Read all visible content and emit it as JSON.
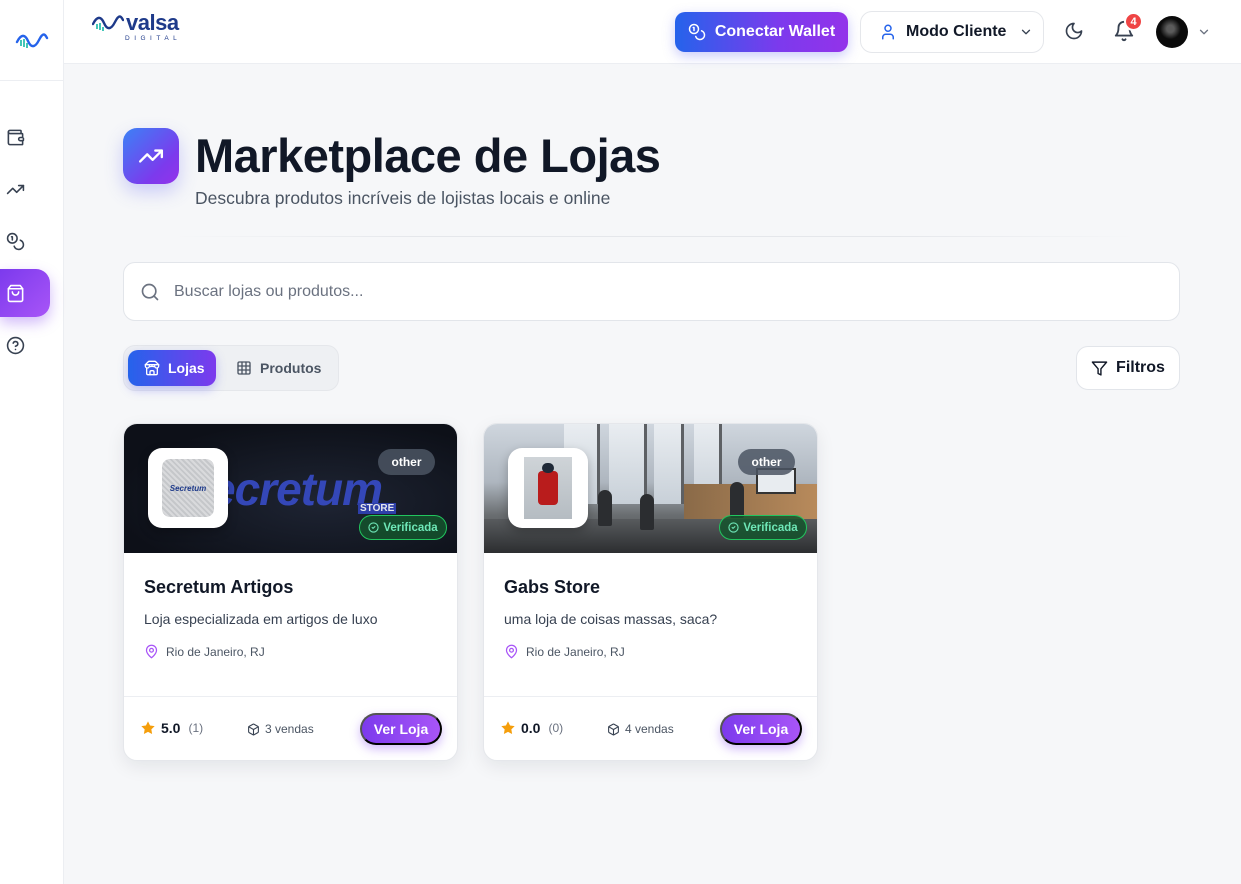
{
  "header": {
    "brand_name": "valsa",
    "brand_sub": "DIGITAL",
    "wallet_button": "Conectar Wallet",
    "mode_button": "Modo Cliente",
    "notification_count": "4"
  },
  "sidebar": {
    "items": [
      {
        "name": "wallet-icon"
      },
      {
        "name": "trending-up-icon"
      },
      {
        "name": "coins-icon"
      },
      {
        "name": "shopping-bag-icon",
        "active": true
      },
      {
        "name": "help-circle-icon"
      }
    ]
  },
  "page": {
    "title": "Marketplace de Lojas",
    "subtitle": "Descubra produtos incríveis de lojistas locais e online"
  },
  "search": {
    "placeholder": "Buscar lojas ou produtos...",
    "value": ""
  },
  "tabs": {
    "stores": "Lojas",
    "products": "Produtos",
    "active": "stores"
  },
  "filters_button": "Filtros",
  "stores": [
    {
      "name": "Secretum Artigos",
      "description": "Loja especializada em artigos de luxo",
      "location": "Rio de Janeiro, RJ",
      "category": "other",
      "verified": "Verificada",
      "rating": "5.0",
      "reviews": "(1)",
      "sales": "3 vendas",
      "button": "Ver Loja",
      "banner_text": "ecretum",
      "banner_sub": "STORE",
      "logo_text": "Secretum"
    },
    {
      "name": "Gabs Store",
      "description": "uma loja de coisas massas, saca?",
      "location": "Rio de Janeiro, RJ",
      "category": "other",
      "verified": "Verificada",
      "rating": "0.0",
      "reviews": "(0)",
      "sales": "4 vendas",
      "button": "Ver Loja"
    }
  ],
  "colors": {
    "primary_gradient_start": "#2563eb",
    "primary_gradient_end": "#7c3aed",
    "accent_purple": "#a855f7",
    "star": "#f59e0b",
    "badge_red": "#ef4444"
  }
}
